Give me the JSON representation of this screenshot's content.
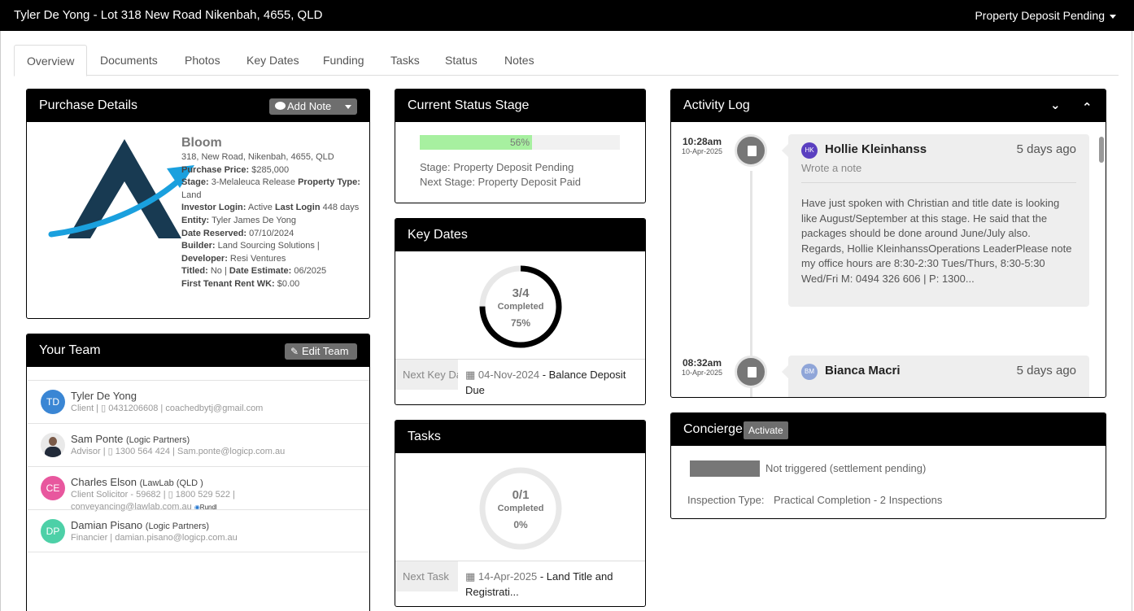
{
  "header": {
    "title": "Tyler De Yong - Lot 318 New Road Nikenbah, 4655, QLD",
    "status": "Property Deposit Pending"
  },
  "tabs": [
    "Overview",
    "Documents",
    "Photos",
    "Key Dates",
    "Funding",
    "Tasks",
    "Status",
    "Notes"
  ],
  "purchase": {
    "title": "Purchase Details",
    "add_note": "Add Note",
    "name": "Bloom",
    "address": "318, New Road, Nikenbah, 4655, QLD",
    "price_label": "Purchase Price:",
    "price": "$285,000",
    "stage_label": "Stage:",
    "stage": "3-Melaleuca Release",
    "property_type_label": "Property Type:",
    "property_type": "Land",
    "investor_login_label": "Investor Login:",
    "investor_login": "Active",
    "last_login_label": "Last Login",
    "last_login": "448 days",
    "entity_label": "Entity:",
    "entity": "Tyler James De Yong",
    "date_reserved_label": "Date Reserved:",
    "date_reserved": "07/10/2024",
    "builder_label": "Builder:",
    "builder": "Land Sourcing Solutions |",
    "developer_label": "Developer:",
    "developer": "Resi Ventures",
    "titled_label": "Titled:",
    "titled": "No |",
    "date_estimate_label": "Date Estimate:",
    "date_estimate": "06/2025",
    "first_rent_label": "First Tenant Rent WK:",
    "first_rent": "$0.00"
  },
  "team": {
    "title": "Your Team",
    "edit": "Edit Team",
    "members": [
      {
        "initials": "TD",
        "name": "Tyler De Yong",
        "org": "",
        "sub": "Client | ▯ 0431206608 | coachedbytj@gmail.com",
        "color": "#3a86d4"
      },
      {
        "initials": "",
        "name": "Sam Ponte",
        "org": "(Logic Partners)",
        "sub": "Advisor | ▯ 1300 564 424 | Sam.ponte@logicp.com.au",
        "color": "#555555"
      },
      {
        "initials": "CE",
        "name": "Charles Elson",
        "org": "(LawLab (QLD )",
        "sub": "Client Solicitor - 59682 | ▯ 1800 529 522 | conveyancing@lawlab.com.au",
        "extra": "Rundl",
        "color": "#e8579e"
      },
      {
        "initials": "DP",
        "name": "Damian Pisano",
        "org": "(Logic Partners)",
        "sub": "Financier | damian.pisano@logicp.com.au",
        "color": "#4dd0a7"
      }
    ]
  },
  "status_stage": {
    "title": "Current Status Stage",
    "progress": 56,
    "progress_label": "56%",
    "stage": "Stage: Property Deposit Pending",
    "next_stage": "Next Stage: Property Deposit Paid"
  },
  "key_dates": {
    "title": "Key Dates",
    "count": "3/4",
    "completed": "Completed",
    "percent_label": "75%",
    "fraction": 0.75,
    "next_label": "Next Key Date",
    "next_date": "04-Nov-2024",
    "next_text": "Balance Deposit Due"
  },
  "tasks": {
    "title": "Tasks",
    "count": "0/1",
    "completed": "Completed",
    "percent_label": "0%",
    "fraction": 0,
    "next_label": "Next Task",
    "next_date": "14-Apr-2025",
    "next_text": "Land Title and Registrati..."
  },
  "activity": {
    "title": "Activity Log",
    "entries": [
      {
        "time": "10:28am",
        "date": "10-Apr-2025",
        "initials": "HK",
        "user": "Hollie Kleinhanss",
        "ago": "5 days ago",
        "kind": "Wrote a note",
        "text": "Have just spoken with Christian and title date is looking like August/September at this stage. He said that the packages should be done around June/July also.\n   Regards, Hollie KleinhanssOperations LeaderPlease note my office hours are 8:30-2:30 Tues/Thurs, 8:30-5:30 Wed/Fri M: 0494 326 606 |  P: 1300...",
        "color": "#5a3fc0"
      },
      {
        "time": "08:32am",
        "date": "10-Apr-2025",
        "initials": "BM",
        "user": "Bianca Macri",
        "ago": "5 days ago",
        "color": "#8fa5d8"
      }
    ]
  },
  "concierge": {
    "title": "Concierge",
    "activate": "Activate",
    "state": "Not triggered (settlement pending)",
    "inspection_label": "Inspection Type:",
    "inspection": "Practical Completion - 2 Inspections"
  }
}
